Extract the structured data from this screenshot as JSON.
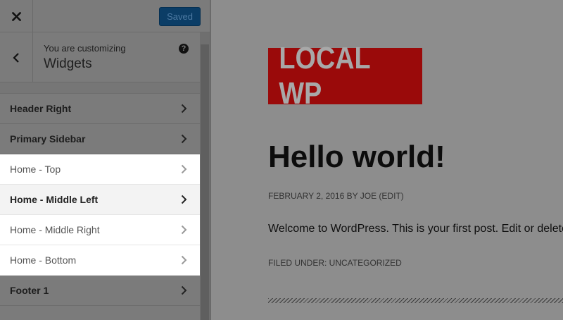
{
  "topbar": {
    "close_icon": "close-icon",
    "save_label": "Saved",
    "save_color": "#0b3d66"
  },
  "header": {
    "customizing_label": "You are customizing",
    "title": "Widgets",
    "help_glyph": "?",
    "back_icon": "chevron-left-icon"
  },
  "sections": [
    {
      "label": "Header Right",
      "state": "normal"
    },
    {
      "label": "Primary Sidebar",
      "state": "normal"
    },
    {
      "label": "Home - Top",
      "state": "highlight"
    },
    {
      "label": "Home - Middle Left",
      "state": "highlight-dark"
    },
    {
      "label": "Home - Middle Right",
      "state": "highlight"
    },
    {
      "label": "Home - Bottom",
      "state": "highlight"
    },
    {
      "label": "Footer 1",
      "state": "normal"
    }
  ],
  "preview": {
    "logo_text": "LOCAL WP",
    "logo_color": "#9a0a0a",
    "post_title": "Hello world!",
    "post_meta": "FEBRUARY 2, 2016 BY JOE (EDIT)",
    "post_body": "Welcome to WordPress. This is your first post. Edit or delete",
    "post_categories": "FILED UNDER: UNCATEGORIZED"
  }
}
